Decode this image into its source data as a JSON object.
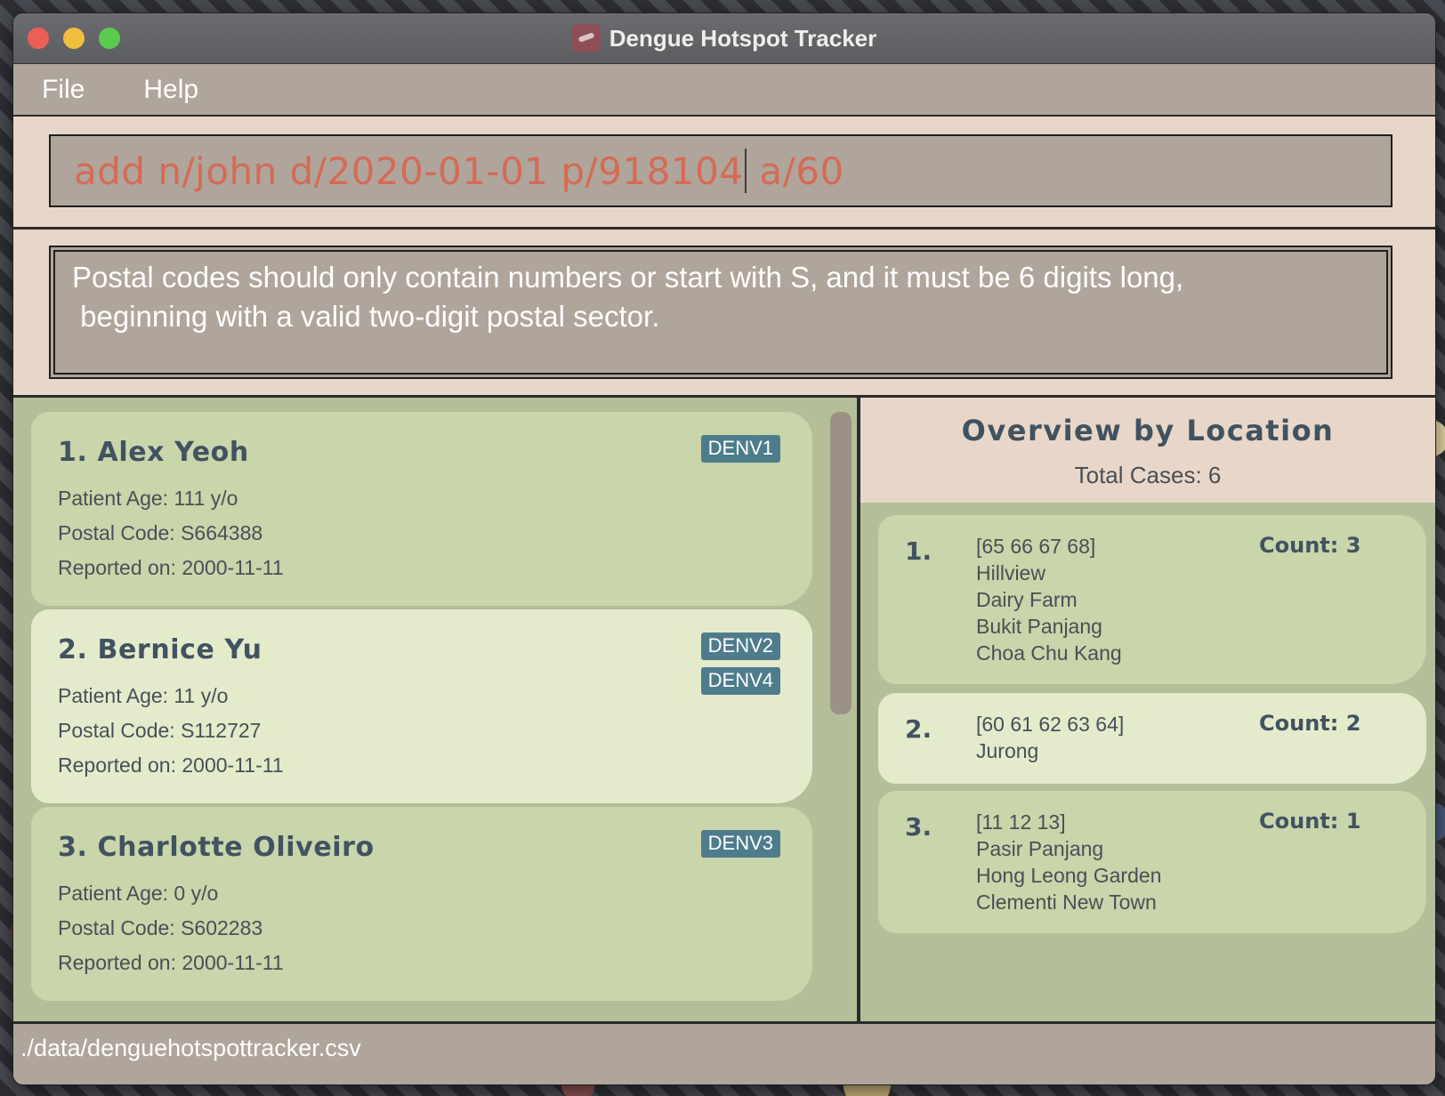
{
  "window": {
    "title": "Dengue Hotspot Tracker"
  },
  "menu": {
    "file": "File",
    "help": "Help"
  },
  "command": {
    "before_caret": "add n/john d/2020-01-01 p/918104",
    "after_caret": " a/60"
  },
  "result": {
    "message": "Postal codes should only contain numbers or start with S, and it must be 6 digits long,\n beginning with a valid two-digit postal sector."
  },
  "patients": [
    {
      "name": "1. Alex Yeoh",
      "age": "Patient Age: 111 y/o",
      "postal": "Postal Code: S664388",
      "reported": "Reported on: 2000-11-11",
      "tags": [
        "DENV1"
      ]
    },
    {
      "name": "2. Bernice Yu",
      "age": "Patient Age: 11 y/o",
      "postal": "Postal Code: S112727",
      "reported": "Reported on: 2000-11-11",
      "tags": [
        "DENV2",
        "DENV4"
      ]
    },
    {
      "name": "3. Charlotte Oliveiro",
      "age": "Patient Age: 0 y/o",
      "postal": "Postal Code: S602283",
      "reported": "Reported on: 2000-11-11",
      "tags": [
        "DENV3"
      ]
    }
  ],
  "overview": {
    "title": "Overview by Location",
    "total": "Total Cases: 6",
    "items": [
      {
        "index": "1.",
        "sectors": "[65 66 67 68]",
        "places": [
          "Hillview",
          "Dairy Farm",
          "Bukit Panjang",
          "Choa Chu Kang"
        ],
        "count": "Count: 3"
      },
      {
        "index": "2.",
        "sectors": "[60 61 62 63 64]",
        "places": [
          "Jurong"
        ],
        "count": "Count: 2"
      },
      {
        "index": "3.",
        "sectors": "[11 12 13]",
        "places": [
          "Pasir Panjang",
          "Hong Leong Garden",
          "Clementi New Town"
        ],
        "count": "Count: 1"
      }
    ]
  },
  "status": {
    "path": "./data/denguehotspottracker.csv"
  },
  "colors": {
    "command_text": "#d46b56",
    "tag_bg": "#4e7c8c",
    "card": "#c9d5ab",
    "card_alt": "#e4ebcb",
    "pane_bg": "#b4bf9a",
    "header_bg": "#e8d7c8"
  }
}
